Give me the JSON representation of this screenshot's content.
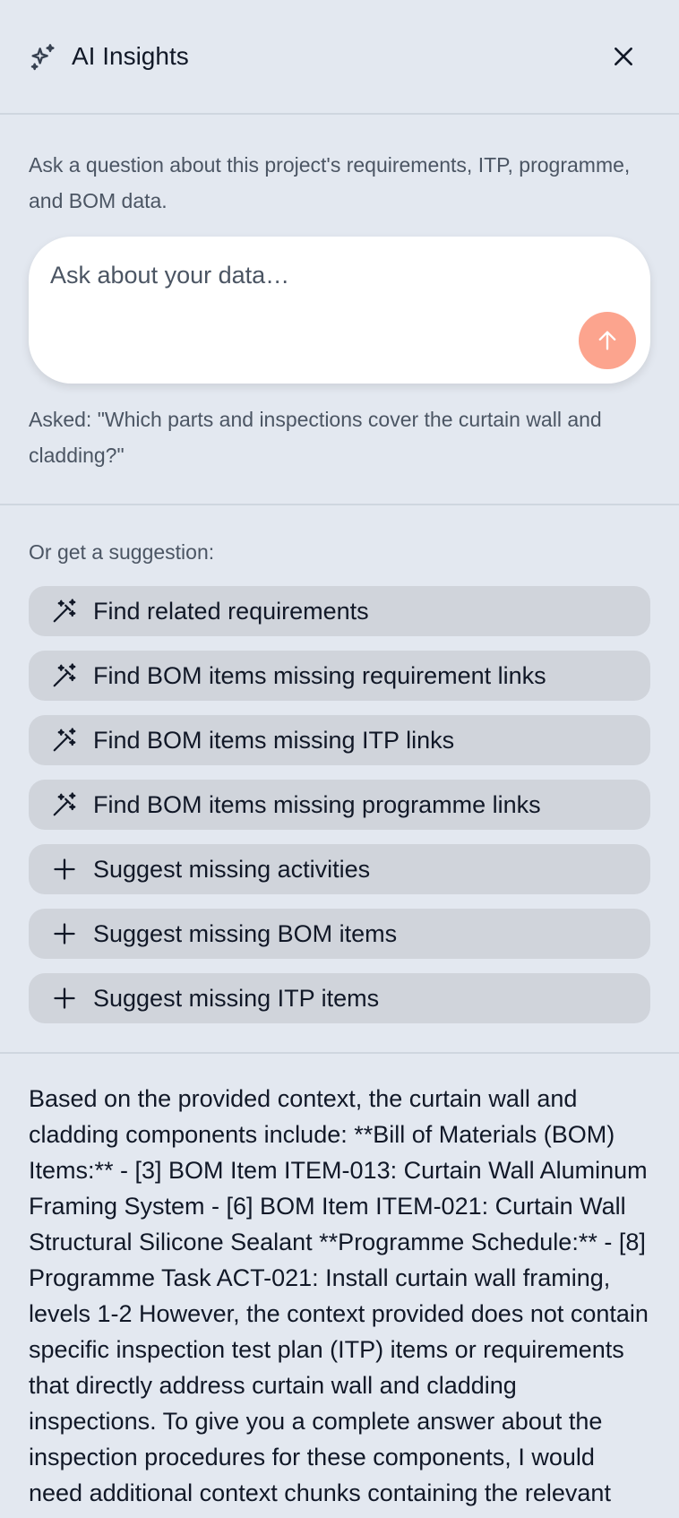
{
  "header": {
    "title": "AI Insights",
    "title_icon": "sparkles-icon",
    "close_icon": "close-icon"
  },
  "ask": {
    "intro": "Ask a question about this project's requirements, ITP, programme, and BOM data.",
    "input_placeholder": "Ask about your data…",
    "input_value": "",
    "send_icon": "arrow-up-icon",
    "asked": "Asked: \"Which parts and inspections cover the curtain wall and cladding?\""
  },
  "suggestions": {
    "label": "Or get a suggestion:",
    "items": [
      {
        "label": "Find related requirements",
        "icon": "magic-wand-icon"
      },
      {
        "label": "Find BOM items missing requirement links",
        "icon": "magic-wand-icon"
      },
      {
        "label": "Find BOM items missing ITP links",
        "icon": "magic-wand-icon"
      },
      {
        "label": "Find BOM items missing programme links",
        "icon": "magic-wand-icon"
      },
      {
        "label": "Suggest missing activities",
        "icon": "plus-icon"
      },
      {
        "label": "Suggest missing BOM items",
        "icon": "plus-icon"
      },
      {
        "label": "Suggest missing ITP items",
        "icon": "plus-icon"
      }
    ]
  },
  "answer": {
    "text": "Based on the provided context, the curtain wall and cladding components include: **Bill of Materials (BOM) Items:** - [3] BOM Item ITEM-013: Curtain Wall Aluminum Framing System - [6] BOM Item ITEM-021: Curtain Wall Structural Silicone Sealant **Programme Schedule:** - [8] Programme Task ACT-021: Install curtain wall framing, levels 1-2 However, the context provided does not contain specific inspection test plan (ITP) items or requirements that directly address curtain wall and cladding inspections. To give you a complete answer about the inspection procedures for these components, I would need additional context chunks containing the relevant ITP details."
  },
  "colors": {
    "background": "#e3e8f0",
    "chip_background": "#d0d4db",
    "send_button": "#fca48e",
    "divider": "#cfd6df"
  }
}
